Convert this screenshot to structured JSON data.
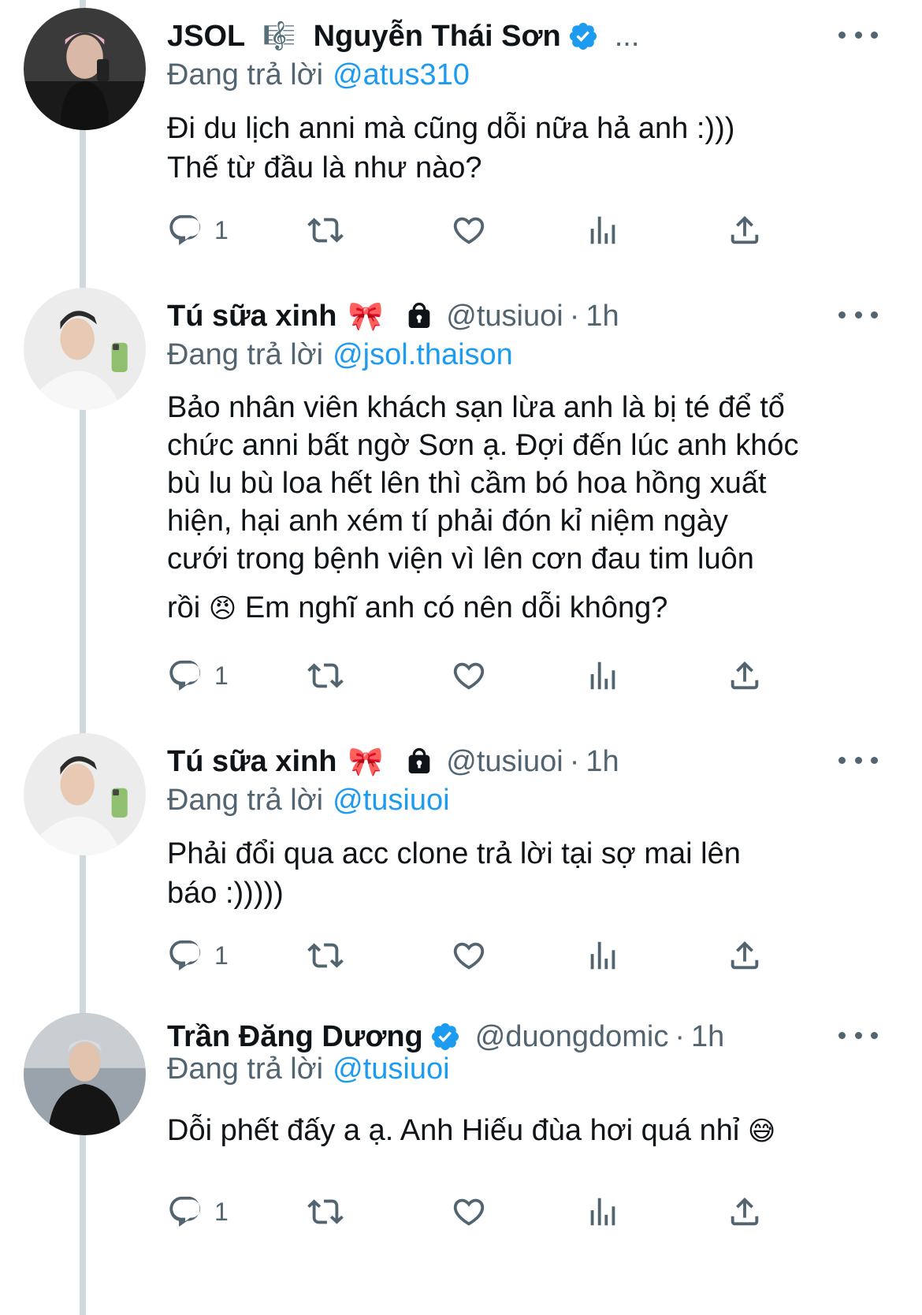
{
  "tweets": [
    {
      "name": "JSOL",
      "name_emoji": "🎼",
      "name2": "Nguyễn Thái Sơn",
      "verified": true,
      "extra": "...",
      "replying_label": "Đang trả lời",
      "replying_to": "@atus310",
      "text": [
        "Đi du lịch anni mà cũng dỗi nữa hả anh :)))",
        "Thế từ đầu là như nào?"
      ],
      "reply_count": "1"
    },
    {
      "name": "Tú sữa xinh",
      "name_emoji": "🎀",
      "lock_icon": "lock-icon",
      "handle": "@tusiuoi",
      "time": "1h",
      "replying_label": "Đang trả lời",
      "replying_to": "@jsol.thaison",
      "text": [
        "Bảo nhân viên khách sạn lừa anh là bị té để tổ",
        "chức anni bất ngờ Sơn ạ. Đợi đến lúc anh khóc",
        "bù lu bù loa hết lên thì cầm bó hoa hồng xuất",
        "hiện, hại anh xém tí phải đón kỉ niệm ngày",
        "cưới trong bệnh viện vì lên cơn đau tim luôn"
      ],
      "text_last_pre": "rồi",
      "text_emoji": "😠",
      "text_last_post": "Em nghĩ anh có nên dỗi không?",
      "reply_count": "1"
    },
    {
      "name": "Tú sữa xinh",
      "name_emoji": "🎀",
      "lock_icon": "lock-icon",
      "handle": "@tusiuoi",
      "time": "1h",
      "replying_label": "Đang trả lời",
      "replying_to": "@tusiuoi",
      "text": [
        "Phải đổi qua acc clone trả lời tại sợ mai lên",
        "báo :)))))"
      ],
      "reply_count": "1"
    },
    {
      "name": "Trần Đăng Dương",
      "verified": true,
      "handle": "@duongdomic",
      "time": "1h",
      "replying_label": "Đang trả lời",
      "replying_to": "@tusiuoi",
      "text_pre": "Dỗi phết đấy a ạ. Anh Hiếu đùa hơi quá nhỉ",
      "text_emoji": "😅",
      "reply_count": "1"
    }
  ],
  "time_separator": "·",
  "colors": {
    "text": "#0f1419",
    "secondary": "#536471",
    "accent": "#1d9bf0",
    "thread_line": "#cfd9de"
  },
  "icons": [
    "reply-icon",
    "retweet-icon",
    "like-icon",
    "views-icon",
    "share-icon",
    "verified-badge-icon",
    "more-icon"
  ]
}
